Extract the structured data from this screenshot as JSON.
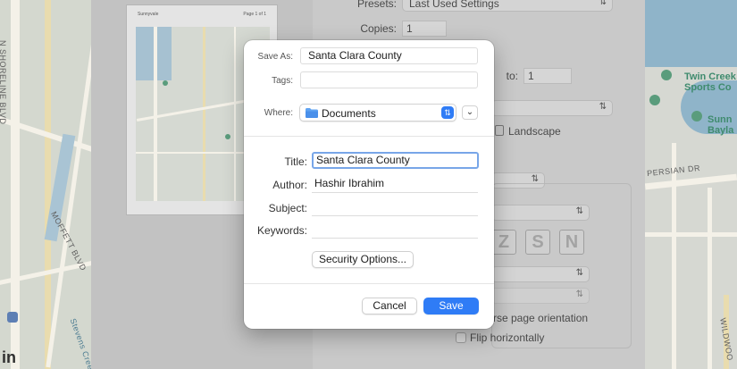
{
  "dialog": {
    "save_as_label": "Save As:",
    "save_as_value": "Santa Clara County",
    "tags_label": "Tags:",
    "tags_value": "",
    "where_label": "Where:",
    "where_value": "Documents",
    "title_label": "Title:",
    "title_value": "Santa Clara County",
    "author_label": "Author:",
    "author_value": "Hashir Ibrahim",
    "subject_label": "Subject:",
    "subject_value": "",
    "keywords_label": "Keywords:",
    "keywords_value": "",
    "security_button": "Security Options...",
    "cancel_button": "Cancel",
    "save_button": "Save"
  },
  "print_settings": {
    "presets_label": "Presets:",
    "presets_value": "Last Used Settings",
    "copies_label": "Copies:",
    "copies_value": "1",
    "to_label": "to:",
    "to_value": "1",
    "landscape_label": "Landscape",
    "reverse_label": "rse page orientation",
    "flip_label": "Flip horizontally"
  },
  "preview": {
    "title": "Sunnyvale",
    "pages": "Page 1 of 1"
  },
  "map": {
    "street_left_1": "N SHORELINE BLVD",
    "street_left_2": "MOFFETT BLVD",
    "street_left_3": "Stevens Creek",
    "poi_right_1": "Twin Creek\nSports Co",
    "poi_right_2": "Sunn\nBayla",
    "street_right_1": "PERSIAN DR",
    "street_right_2": "WILDWOO",
    "logo": "in"
  },
  "colors": {
    "accent": "#2f7cf6",
    "focus_ring": "#78a6e8"
  }
}
